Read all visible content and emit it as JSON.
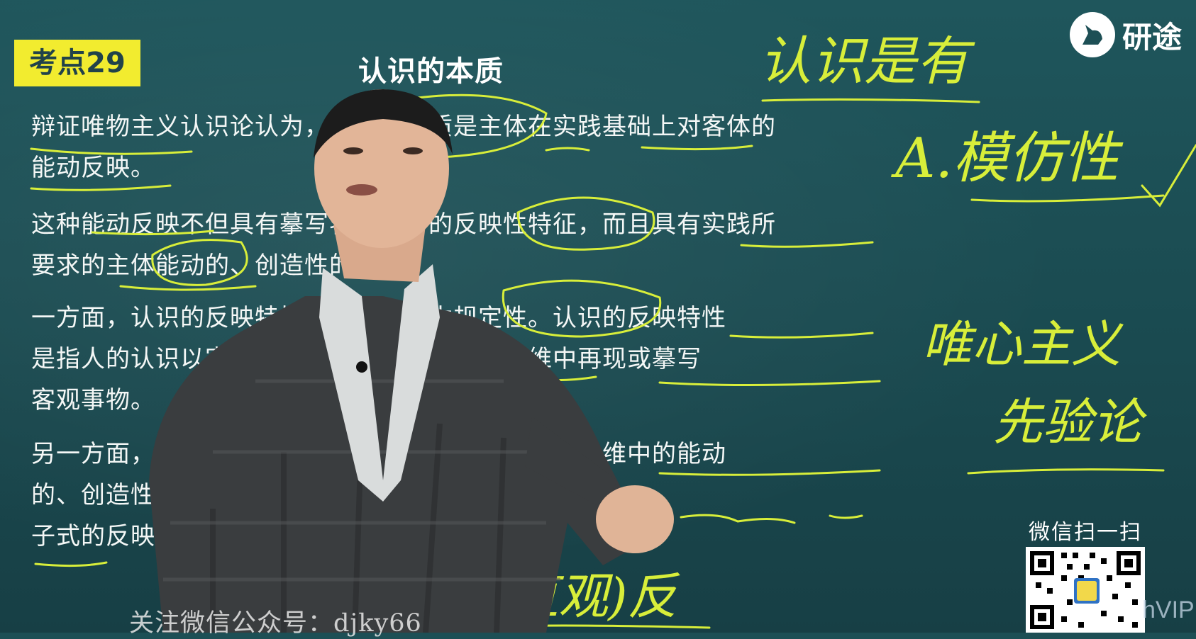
{
  "badge": "考点29",
  "title": "认识的本质",
  "paragraphs": {
    "p1": [
      "辩证唯物主义认识论认为，认识的本质是主体在实践基础上对客体的",
      "能动反映。"
    ],
    "p2": [
      "这种能动反映不但具有摹写客体内容的反映性特征，而且具有实践所",
      "要求的主体能动的、创造性的特征。"
    ],
    "p3": [
      "一方面，认识的反映特性是认识的基本规定性。认识的反映特性",
      "是指人的认识以客观事物为原型和摹本，在思维中再现或摹写",
      "客观事物。"
    ],
    "p4": [
      "另一方面，认识的反映特性又表明，认识是一种在思维中的能动",
      "的、创造性的反映，而不是对客体直接的描摹或照镜",
      "子式的反映。"
    ]
  },
  "logo": {
    "text": "研途",
    "icon": "unicorn-icon"
  },
  "handwriting": {
    "top": "认识是有",
    "a": "A.模仿性",
    "mid1": "唯心主义",
    "mid2": "先验论",
    "bottom": "(直观)反"
  },
  "wechat_scan": "微信扫一扫",
  "follow_text": "关注微信公众号：djky66",
  "vip_text": "hVIP",
  "colors": {
    "chalk_yellow": "#d8ee3a",
    "board": "#1d4f55",
    "badge": "#f2ec2f"
  }
}
